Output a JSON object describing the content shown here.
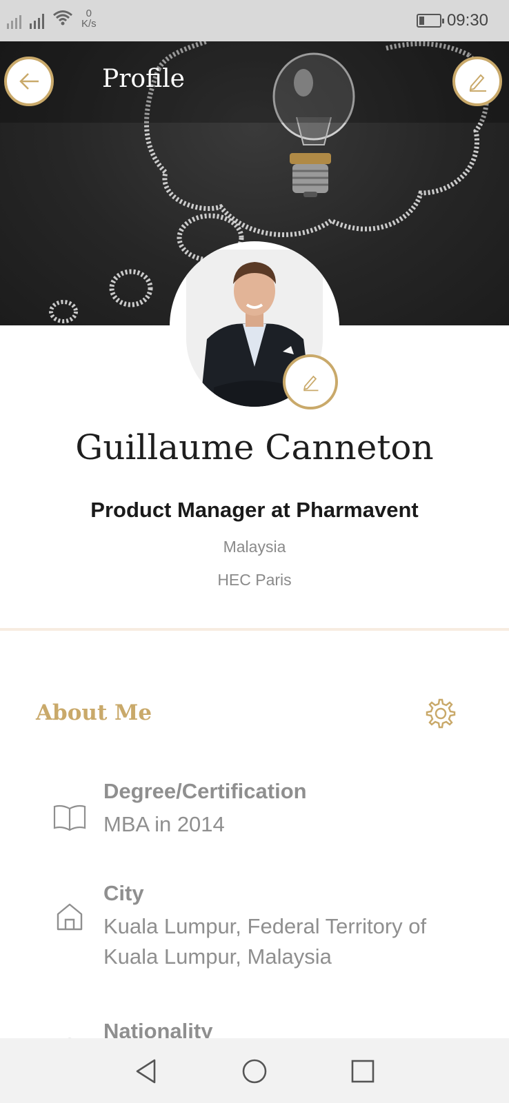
{
  "status_bar": {
    "speed_value": "0",
    "speed_unit": "K/s",
    "time": "09:30",
    "battery_level": 0.25
  },
  "header": {
    "title": "Profile",
    "back_icon": "arrow-left-icon",
    "edit_icon": "pencil-icon"
  },
  "profile": {
    "name": "Guillaume Canneton",
    "role": "Product Manager at Pharmavent",
    "country": "Malaysia",
    "school": "HEC Paris",
    "avatar_edit_icon": "pencil-icon"
  },
  "about": {
    "title": "About Me",
    "settings_icon": "gear-icon",
    "items": [
      {
        "label": "Degree/Certification",
        "value": "MBA in 2014",
        "icon": "book-icon"
      },
      {
        "label": "City",
        "value": "Kuala Lumpur, Federal Territory of Kuala Lumpur, Malaysia",
        "icon": "home-icon"
      },
      {
        "label": "Nationality",
        "value": "",
        "icon": "globe-icon"
      }
    ]
  },
  "nav": {
    "back_icon": "triangle-back-icon",
    "home_icon": "circle-home-icon",
    "recents_icon": "square-recents-icon"
  },
  "colors": {
    "accent": "#c9a96a",
    "text_muted": "#8f8f8f",
    "divider": "#f7ece0"
  }
}
